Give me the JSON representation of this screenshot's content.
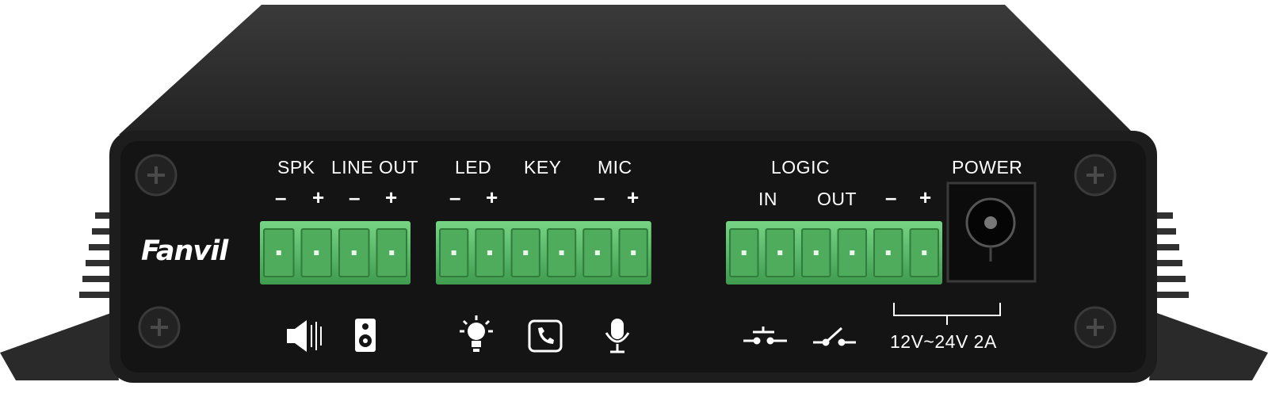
{
  "device": {
    "brand": "Fanvil",
    "labels": {
      "spk": "SPK",
      "line_out": "LINE OUT",
      "led": "LED",
      "key": "KEY",
      "mic": "MIC",
      "logic": "LOGIC",
      "logic_in": "IN",
      "logic_out": "OUT",
      "power": "POWER",
      "power_rating": "12V~24V 2A"
    },
    "polarity": {
      "minus": "–",
      "plus": "+"
    },
    "terminal_blocks": [
      {
        "name": "audio-terminal",
        "pins": 4
      },
      {
        "name": "io-terminal",
        "pins": 6
      },
      {
        "name": "logic-terminal",
        "pins": 6
      }
    ],
    "icons": [
      "speaker-icon",
      "line-out-speaker-icon",
      "bulb-icon",
      "phone-key-icon",
      "microphone-icon",
      "push-button-icon",
      "relay-switch-icon",
      "power-jack-icon"
    ],
    "colors": {
      "body": "#1c1c1c",
      "panel": "#141414",
      "terminal": "#5cbf6a",
      "label": "#ffffff"
    }
  }
}
